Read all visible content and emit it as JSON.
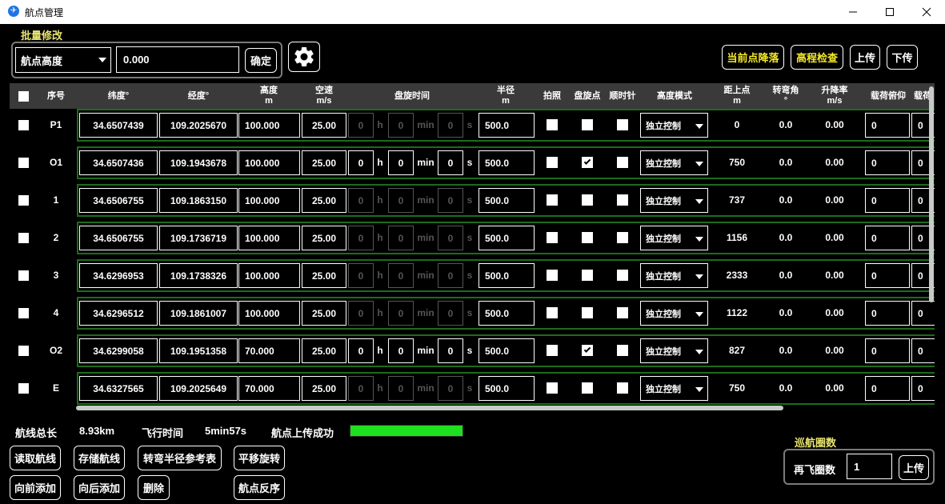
{
  "window": {
    "title": "航点管理",
    "icon": "app-logo-icon"
  },
  "batch": {
    "section_title": "批量修改",
    "field_selected": "航点高度",
    "value": "0.000",
    "confirm_label": "确定",
    "settings_icon": "gear-icon"
  },
  "toolbar": {
    "land_current": "当前点降落",
    "elevation_check": "高程检查",
    "upload": "上传",
    "download": "下传"
  },
  "table": {
    "headers": {
      "index": "序号",
      "lat": "纬度°",
      "lon": "经度°",
      "alt": "高度",
      "alt_unit": "m",
      "speed": "空速",
      "speed_unit": "m/s",
      "loiter_time": "盘旋时间",
      "radius": "半径",
      "radius_unit": "m",
      "photo": "拍照",
      "loiter_point": "盘旋点",
      "clockwise": "顺时针",
      "alt_mode": "高度模式",
      "dist_prev": "距上点",
      "dist_unit": "m",
      "turn_angle": "转弯角",
      "turn_unit": "°",
      "climb_rate": "升降率",
      "climb_unit": "m/s",
      "payload_pitch": "载荷俯仰",
      "payload_next": "载荷"
    },
    "time_units": {
      "h": "h",
      "min": "min",
      "s": "s"
    },
    "rows": [
      {
        "id": "P1",
        "lat": "34.6507439",
        "lon": "109.2025670",
        "alt": "100.000",
        "speed": "25.00",
        "h": "0",
        "min": "0",
        "s": "0",
        "time_enabled": false,
        "radius": "500.0",
        "photo": false,
        "loiter": false,
        "cw": false,
        "mode": "独立控制",
        "dist": "0",
        "turn": "0.0",
        "climb": "0.00",
        "pitch": "0",
        "next": "0"
      },
      {
        "id": "O1",
        "lat": "34.6507436",
        "lon": "109.1943678",
        "alt": "100.000",
        "speed": "25.00",
        "h": "0",
        "min": "0",
        "s": "0",
        "time_enabled": true,
        "radius": "500.0",
        "photo": false,
        "loiter": true,
        "cw": false,
        "mode": "独立控制",
        "dist": "750",
        "turn": "0.0",
        "climb": "0.00",
        "pitch": "0",
        "next": "0"
      },
      {
        "id": "1",
        "lat": "34.6506755",
        "lon": "109.1863150",
        "alt": "100.000",
        "speed": "25.00",
        "h": "0",
        "min": "0",
        "s": "0",
        "time_enabled": false,
        "radius": "500.0",
        "photo": false,
        "loiter": false,
        "cw": false,
        "mode": "独立控制",
        "dist": "737",
        "turn": "0.0",
        "climb": "0.00",
        "pitch": "0",
        "next": "0"
      },
      {
        "id": "2",
        "lat": "34.6506755",
        "lon": "109.1736719",
        "alt": "100.000",
        "speed": "25.00",
        "h": "0",
        "min": "0",
        "s": "0",
        "time_enabled": false,
        "radius": "500.0",
        "photo": false,
        "loiter": false,
        "cw": false,
        "mode": "独立控制",
        "dist": "1156",
        "turn": "0.0",
        "climb": "0.00",
        "pitch": "0",
        "next": "0"
      },
      {
        "id": "3",
        "lat": "34.6296953",
        "lon": "109.1738326",
        "alt": "100.000",
        "speed": "25.00",
        "h": "0",
        "min": "0",
        "s": "0",
        "time_enabled": false,
        "radius": "500.0",
        "photo": false,
        "loiter": false,
        "cw": false,
        "mode": "独立控制",
        "dist": "2333",
        "turn": "0.0",
        "climb": "0.00",
        "pitch": "0",
        "next": "0"
      },
      {
        "id": "4",
        "lat": "34.6296512",
        "lon": "109.1861007",
        "alt": "100.000",
        "speed": "25.00",
        "h": "0",
        "min": "0",
        "s": "0",
        "time_enabled": false,
        "radius": "500.0",
        "photo": false,
        "loiter": false,
        "cw": false,
        "mode": "独立控制",
        "dist": "1122",
        "turn": "0.0",
        "climb": "0.00",
        "pitch": "0",
        "next": "0"
      },
      {
        "id": "O2",
        "lat": "34.6299058",
        "lon": "109.1951358",
        "alt": "70.000",
        "speed": "25.00",
        "h": "0",
        "min": "0",
        "s": "0",
        "time_enabled": true,
        "radius": "500.0",
        "photo": false,
        "loiter": true,
        "cw": false,
        "mode": "独立控制",
        "dist": "827",
        "turn": "0.0",
        "climb": "0.00",
        "pitch": "0",
        "next": "0"
      },
      {
        "id": "E",
        "lat": "34.6327565",
        "lon": "109.2025649",
        "alt": "70.000",
        "speed": "25.00",
        "h": "0",
        "min": "0",
        "s": "0",
        "time_enabled": false,
        "radius": "500.0",
        "photo": false,
        "loiter": false,
        "cw": false,
        "mode": "独立控制",
        "dist": "750",
        "turn": "0.0",
        "climb": "0.00",
        "pitch": "0",
        "next": "0"
      }
    ]
  },
  "stats": {
    "total_label": "航线总长",
    "total_value": "8.93km",
    "time_label": "飞行时间",
    "time_value": "5min57s",
    "status": "航点上传成功",
    "progress": 1.0,
    "progress_color": "#1ee01e"
  },
  "actions": {
    "read": "读取航线",
    "save": "存储航线",
    "turn_table": "转弯半径参考表",
    "shift_rotate": "平移旋转",
    "add_forward": "向前添加",
    "add_backward": "向后添加",
    "delete": "删除",
    "reverse": "航点反序"
  },
  "cruise": {
    "section_title": "巡航圈数",
    "label": "再飞圈数",
    "value": "1",
    "upload": "上传"
  },
  "colors": {
    "accent_yellow": "#f5ea2a",
    "section_title": "#e8e46f",
    "row_border": "#1d6b1d",
    "header_bg": "#3a3a3a"
  }
}
